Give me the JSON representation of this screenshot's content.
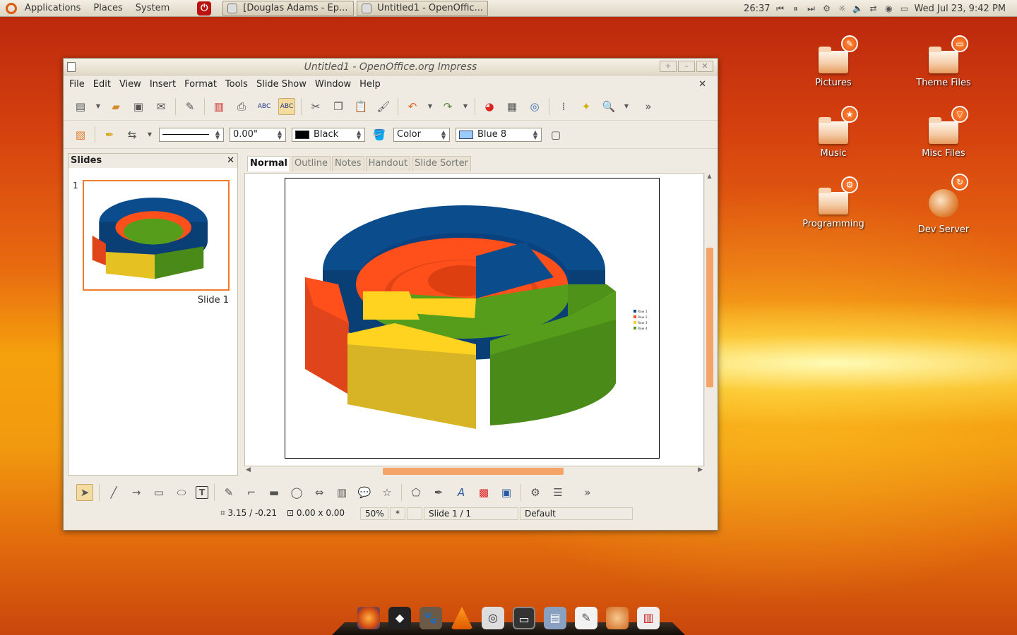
{
  "panel": {
    "menus": [
      "Applications",
      "Places",
      "System"
    ],
    "tasks": [
      "[Douglas Adams - Ep...",
      "Untitled1 - OpenOffic..."
    ],
    "clock_timer": "26:37",
    "datetime": "Wed Jul 23,  9:42 PM"
  },
  "desktop_icons": [
    {
      "label": "Pictures"
    },
    {
      "label": "Theme Files"
    },
    {
      "label": "Music"
    },
    {
      "label": "Misc Files"
    },
    {
      "label": "Programming"
    },
    {
      "label": "Dev Server"
    }
  ],
  "window": {
    "title": "Untitled1 - OpenOffice.org Impress",
    "menus": [
      "File",
      "Edit",
      "View",
      "Insert",
      "Format",
      "Tools",
      "Slide Show",
      "Window",
      "Help"
    ]
  },
  "format_bar": {
    "line_width": "0.00\"",
    "line_color": "Black",
    "area_style": "Color",
    "area_color": "Blue 8",
    "colors": {
      "line_color": "#000000",
      "area_color": "#99ccff"
    }
  },
  "slides_pane": {
    "title": "Slides",
    "slide_number": "1",
    "slide_label": "Slide 1"
  },
  "view_tabs": [
    "Normal",
    "Outline",
    "Notes",
    "Handout",
    "Slide Sorter"
  ],
  "active_tab": "Normal",
  "status": {
    "position": "3.15 / -0.21",
    "size": "0.00 x 0.00",
    "zoom": "50%",
    "modified": "*",
    "slide": "Slide 1 / 1",
    "layout": "Default"
  },
  "chart_data": {
    "type": "donut-3d",
    "series": [
      {
        "name": "Row 1",
        "color": "#0b4c8c"
      },
      {
        "name": "Row 2",
        "color": "#ff4f1a"
      },
      {
        "name": "Row 3",
        "color": "#ffd320"
      },
      {
        "name": "Row 4",
        "color": "#579d1c"
      }
    ],
    "legend": "right"
  }
}
